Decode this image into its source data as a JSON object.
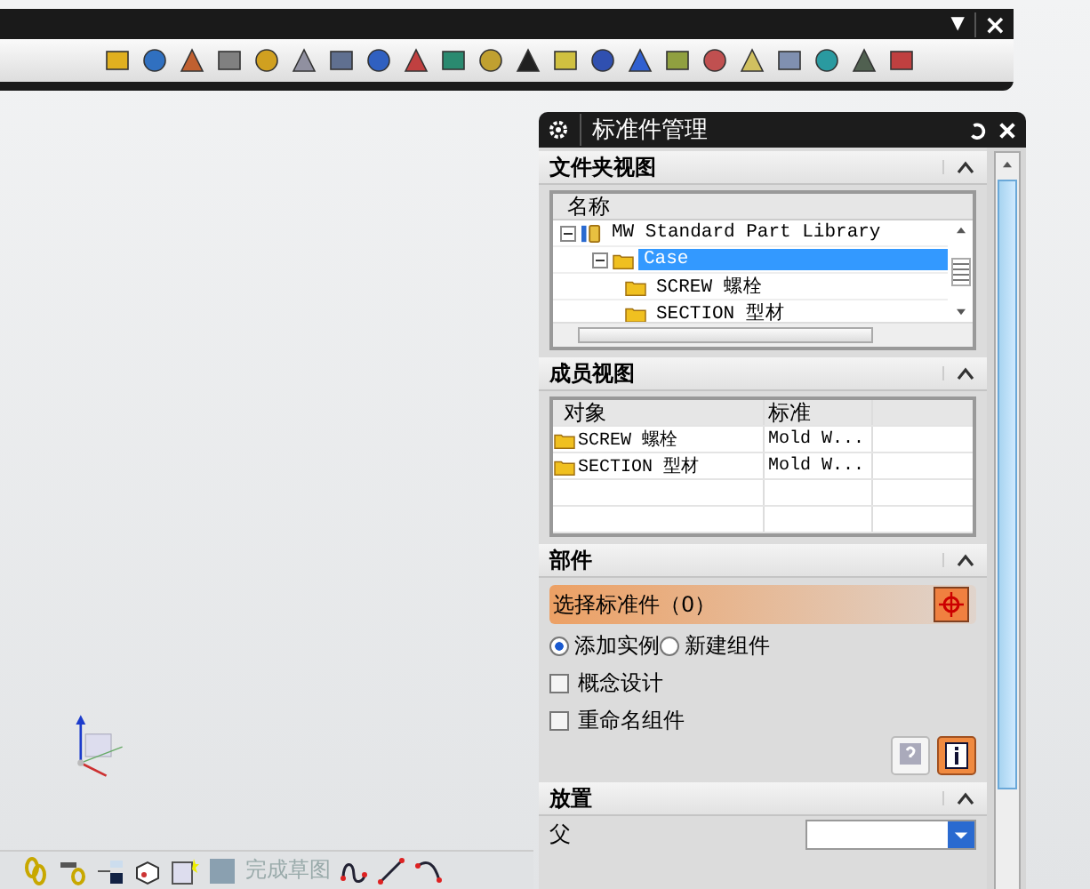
{
  "toolbar": {
    "menu_glyph": "▼",
    "close_glyph": "×"
  },
  "dialog": {
    "title": "标准件管理",
    "folder_view": {
      "title": "文件夹视图",
      "column": "名称",
      "tree": [
        {
          "label": "MW Standard Part Library",
          "expanded": true,
          "selected": false,
          "children": [
            {
              "label": "Case",
              "expanded": true,
              "selected": true,
              "children": [
                {
                  "label": "SCREW 螺栓",
                  "selected": false
                },
                {
                  "label": "SECTION 型材",
                  "selected": false
                }
              ]
            }
          ]
        }
      ]
    },
    "member_view": {
      "title": "成员视图",
      "columns": [
        "对象",
        "标准"
      ],
      "rows": [
        {
          "cells": [
            "SCREW 螺栓",
            "Mold W..."
          ]
        },
        {
          "cells": [
            "SECTION 型材",
            "Mold W..."
          ]
        }
      ]
    },
    "part": {
      "title": "部件",
      "select_label": "选择标准件（0）",
      "radios": [
        {
          "label": "添加实例",
          "selected": true
        },
        {
          "label": "新建组件",
          "selected": false
        }
      ],
      "checkboxes": [
        {
          "label": "概念设计",
          "checked": false
        },
        {
          "label": "重命名组件",
          "checked": false
        }
      ]
    },
    "placement": {
      "title": "放置",
      "fields": [
        {
          "label": "父"
        }
      ]
    }
  },
  "bottom_toolbar": {
    "finish_label": "完成草图"
  }
}
